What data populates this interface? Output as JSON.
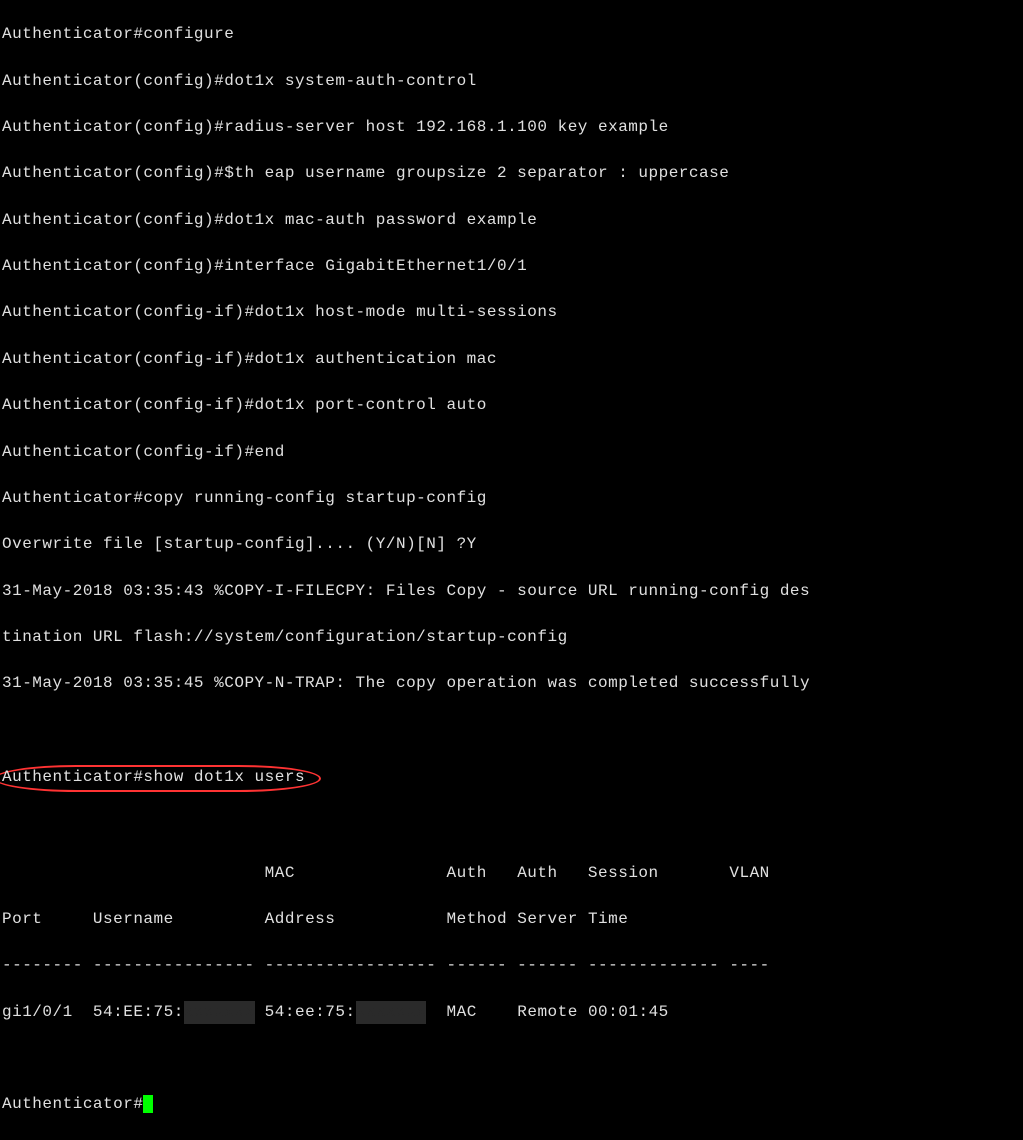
{
  "lines": {
    "l0": "Authenticator#configure",
    "l1": "Authenticator(config)#dot1x system-auth-control",
    "l2": "Authenticator(config)#radius-server host 192.168.1.100 key example",
    "l3": "Authenticator(config)#$th eap username groupsize 2 separator : uppercase",
    "l4": "Authenticator(config)#dot1x mac-auth password example",
    "l5": "Authenticator(config)#interface GigabitEthernet1/0/1",
    "l6": "Authenticator(config-if)#dot1x host-mode multi-sessions",
    "l7": "Authenticator(config-if)#dot1x authentication mac",
    "l8": "Authenticator(config-if)#dot1x port-control auto",
    "l9": "Authenticator(config-if)#end",
    "l10": "Authenticator#copy running-config startup-config",
    "l11": "Overwrite file [startup-config].... (Y/N)[N] ?Y",
    "l12": "31-May-2018 03:35:43 %COPY-I-FILECPY: Files Copy - source URL running-config des",
    "l13": "tination URL flash://system/configuration/startup-config",
    "l14": "31-May-2018 03:35:45 %COPY-N-TRAP: The copy operation was completed successfully",
    "highlighted_prompt": "Authenticator#",
    "highlighted_cmd": "show dot1x users",
    "final_prompt": "Authenticator#"
  },
  "table": {
    "headers": {
      "port": "Port",
      "username": "Username",
      "mac_label1": "MAC",
      "mac_label2": "Address",
      "auth_method1": "Auth",
      "auth_method2": "Method",
      "auth_server1": "Auth",
      "auth_server2": "Server",
      "session1": "Session",
      "session2": "Time",
      "vlan": "VLAN"
    },
    "divider": "-------- ---------------- ----------------- ------ ------ ------------- ----",
    "row": {
      "port": "gi1/0/1",
      "username_visible": "54:EE:75:",
      "mac_visible": "54:ee:75:",
      "method": "MAC",
      "server": "Remote",
      "time": "00:01:45"
    }
  }
}
